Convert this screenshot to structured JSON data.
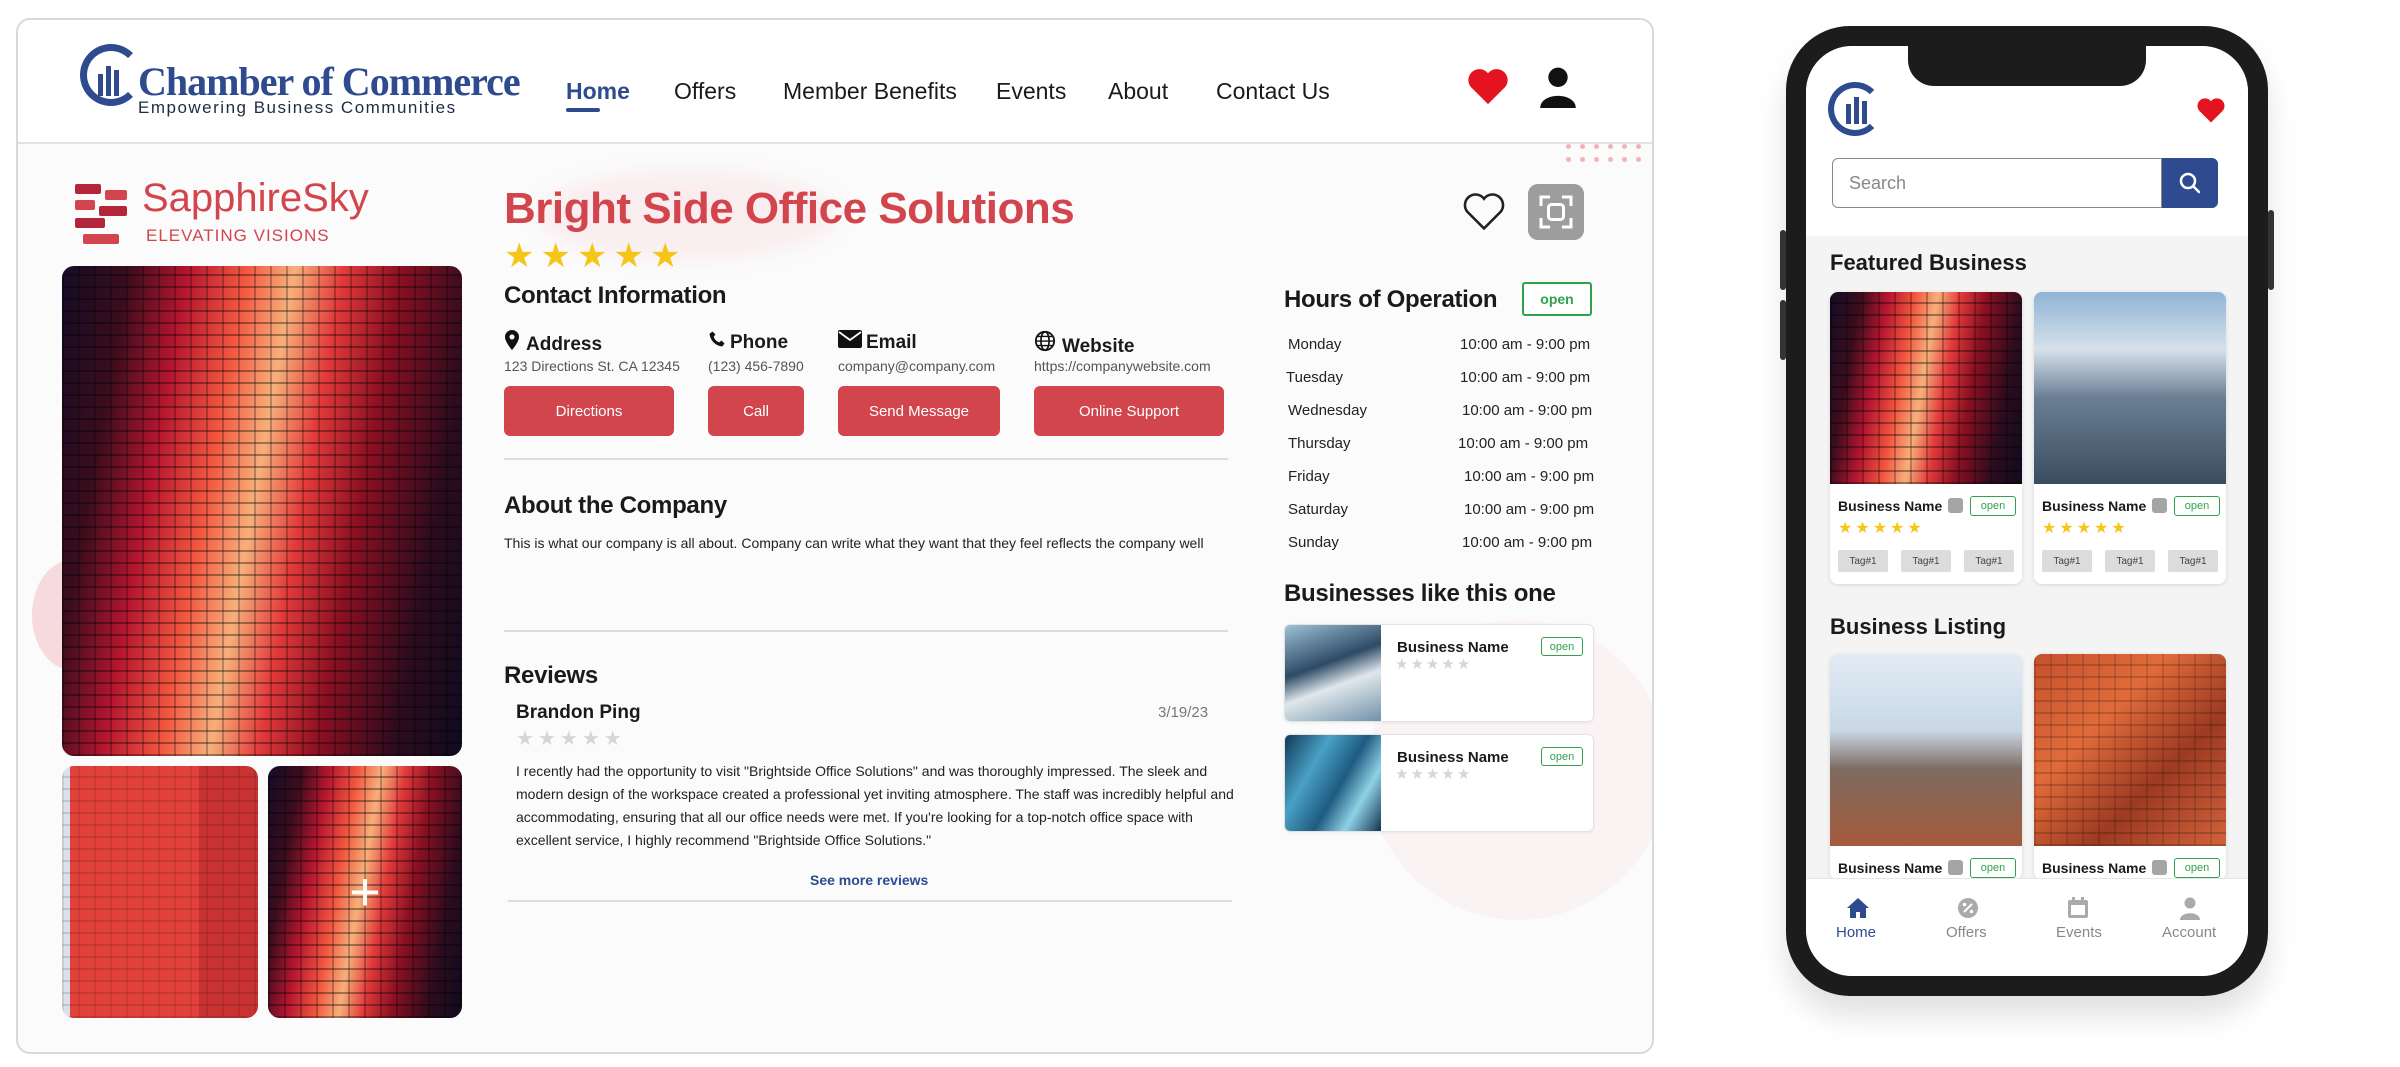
{
  "desktop": {
    "logo": {
      "title": "Chamber of Commerce",
      "subtitle": "Empowering Business Communities"
    },
    "nav": [
      {
        "label": "Home",
        "active": true
      },
      {
        "label": "Offers"
      },
      {
        "label": "Member Benefits"
      },
      {
        "label": "Events"
      },
      {
        "label": "About"
      },
      {
        "label": "Contact Us"
      }
    ],
    "header_icons": {
      "favorites": "heart-icon",
      "account": "user-icon"
    },
    "brand": {
      "name": "SapphireSky",
      "tagline": "ELEVATING VISIONS"
    },
    "company": {
      "title": "Bright Side Office Solutions",
      "rating": 5,
      "contact_heading": "Contact Information",
      "contact": {
        "address": {
          "label": "Address",
          "value": "123 Directions St. CA 12345",
          "button": "Directions",
          "icon": "map-pin-icon"
        },
        "phone": {
          "label": "Phone",
          "value": "(123) 456-7890",
          "button": "Call",
          "icon": "phone-icon"
        },
        "email": {
          "label": "Email",
          "value": "company@company.com",
          "button": "Send Message",
          "icon": "envelope-icon"
        },
        "website": {
          "label": "Website",
          "value": "https://companywebsite.com",
          "button": "Online Support",
          "icon": "globe-icon"
        }
      },
      "about_heading": "About the Company",
      "about_text": "This is what our company is all about. Company can write what they want that they feel reflects the company well"
    },
    "reviews": {
      "heading": "Reviews",
      "items": [
        {
          "author": "Brandon Ping",
          "date": "3/19/23",
          "rating": 0,
          "text": "I recently had the opportunity to visit \"Brightside Office Solutions\" and was thoroughly impressed. The sleek and modern design of the workspace created a professional yet inviting atmosphere. The staff was incredibly helpful and accommodating, ensuring that all our office needs were met. If you're looking for a top-notch office space with excellent service, I highly recommend \"Brightside Office Solutions.\""
        }
      ],
      "see_more": "See more reviews"
    },
    "hours": {
      "heading": "Hours of Operation",
      "status": "open",
      "days": [
        {
          "day": "Monday",
          "time": "10:00 am - 9:00 pm"
        },
        {
          "day": "Tuesday",
          "time": "10:00 am - 9:00 pm"
        },
        {
          "day": "Wednesday",
          "time": "10:00 am - 9:00 pm"
        },
        {
          "day": "Thursday",
          "time": "10:00 am - 9:00 pm"
        },
        {
          "day": "Friday",
          "time": "10:00 am - 9:00 pm"
        },
        {
          "day": "Saturday",
          "time": "10:00 am - 9:00 pm"
        },
        {
          "day": "Sunday",
          "time": "10:00 am - 9:00 pm"
        }
      ]
    },
    "similar": {
      "heading": "Businesses like this one",
      "items": [
        {
          "name": "Business Name",
          "status": "open",
          "rating": 0
        },
        {
          "name": "Business Name",
          "status": "open",
          "rating": 0
        }
      ]
    }
  },
  "phone": {
    "search_placeholder": "Search",
    "featured_heading": "Featured  Business",
    "featured": [
      {
        "name": "Business Name",
        "status": "open",
        "rating": 5,
        "tags": [
          "Tag#1",
          "Tag#1",
          "Tag#1"
        ]
      },
      {
        "name": "Business Name",
        "status": "open",
        "rating": 5,
        "tags": [
          "Tag#1",
          "Tag#1",
          "Tag#1"
        ]
      }
    ],
    "listing_heading": "Business Listing",
    "listing": [
      {
        "name": "Business Name",
        "status": "open"
      },
      {
        "name": "Business Name",
        "status": "open"
      }
    ],
    "tabs": [
      {
        "label": "Home",
        "icon": "home-icon",
        "active": true
      },
      {
        "label": "Offers",
        "icon": "offers-icon"
      },
      {
        "label": "Events",
        "icon": "calendar-icon"
      },
      {
        "label": "Account",
        "icon": "user-icon"
      }
    ]
  },
  "colors": {
    "accent": "#d2454d",
    "brand": "#2e4b8f",
    "open": "#2fa24b",
    "star": "#f5c518"
  }
}
